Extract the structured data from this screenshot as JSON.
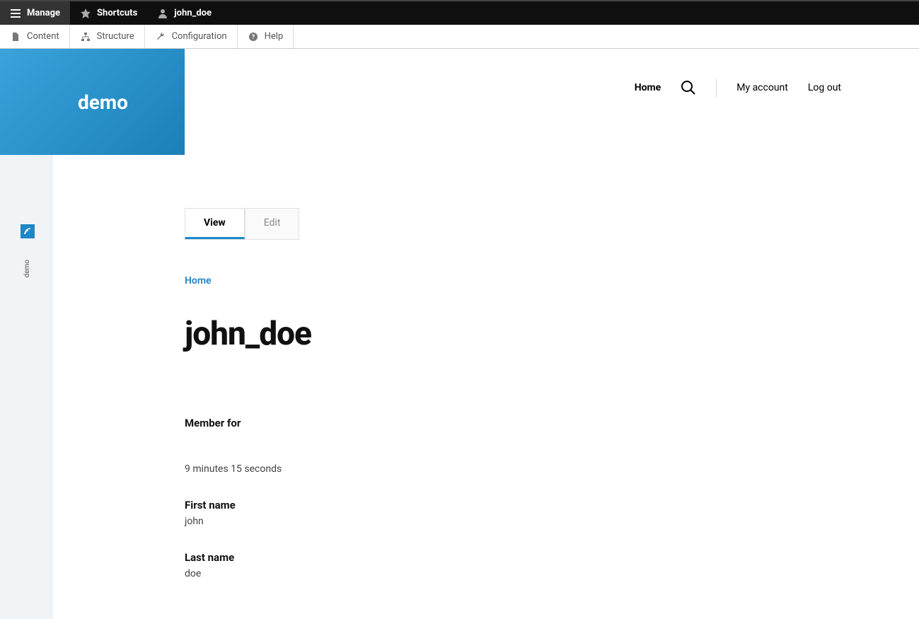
{
  "admin_toolbar": {
    "manage": "Manage",
    "shortcuts": "Shortcuts",
    "user": "john_doe"
  },
  "admin_subtoolbar": {
    "content": "Content",
    "structure": "Structure",
    "configuration": "Configuration",
    "help": "Help"
  },
  "brand": "demo",
  "sidebar": {
    "label": "demo"
  },
  "top_nav": {
    "home": "Home",
    "my_account": "My account",
    "log_out": "Log out"
  },
  "tabs": {
    "view": "View",
    "edit": "Edit"
  },
  "breadcrumb": "Home",
  "page_title": "john_doe",
  "fields": {
    "member_for_label": "Member for",
    "member_for_value": "9 minutes 15 seconds",
    "first_name_label": "First name",
    "first_name_value": "john",
    "last_name_label": "Last name",
    "last_name_value": "doe"
  }
}
